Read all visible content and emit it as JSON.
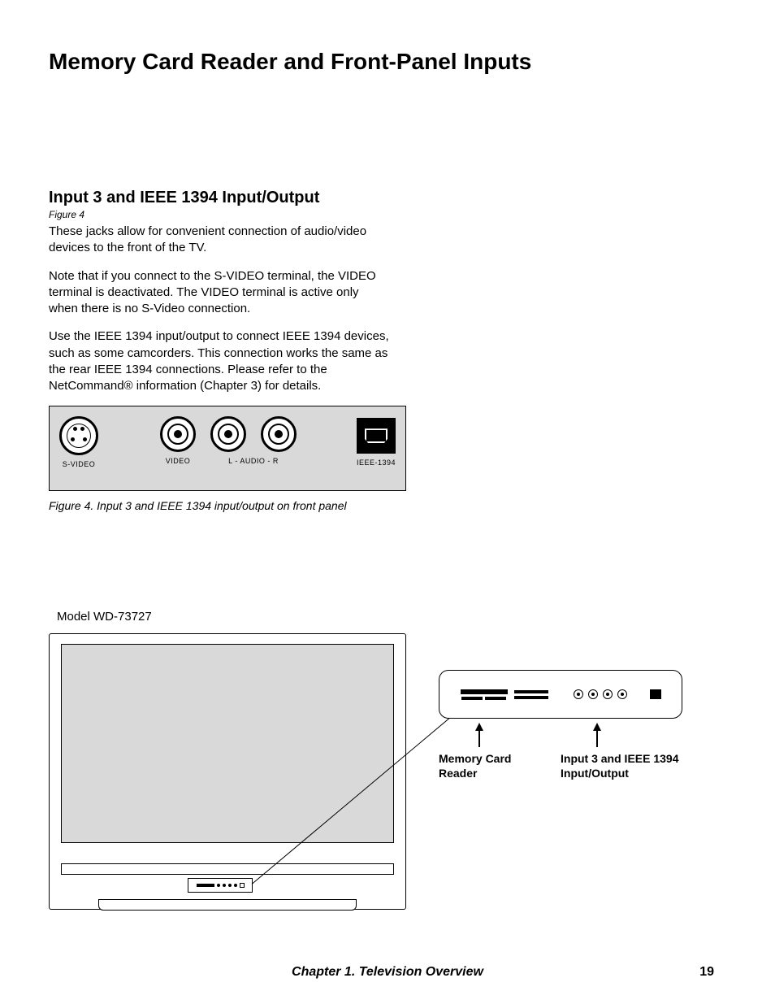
{
  "page_title": "Memory Card Reader and Front-Panel Inputs",
  "section": {
    "heading": "Input 3 and IEEE 1394 Input/Output",
    "figure_ref": "Figure 4",
    "para1": "These jacks allow for convenient connection of audio/video devices to the front of the TV.",
    "para2": "Note that if you connect to the S-VIDEO terminal, the VIDEO terminal is deactivated.  The VIDEO terminal is active only when there is no S-Video connection.",
    "para3": "Use the IEEE 1394 input/output to connect IEEE 1394 devices, such as some camcorders.  This connection works the same as the rear IEEE 1394 connections.  Please refer to the NetCommand® information (Chapter 3) for details."
  },
  "panel": {
    "svideo": "S-VIDEO",
    "video": "VIDEO",
    "audio": "L   -   AUDIO   -   R",
    "ieee": "IEEE-1394"
  },
  "figure_caption": "Figure 4.  Input 3 and IEEE 1394 input/output on front panel",
  "model_label": "Model WD-73727",
  "callouts": {
    "memory_card": "Memory Card Reader",
    "input3": "Input 3 and IEEE 1394 Input/Output"
  },
  "footer": {
    "chapter": "Chapter 1. Television Overview",
    "page": "19"
  }
}
